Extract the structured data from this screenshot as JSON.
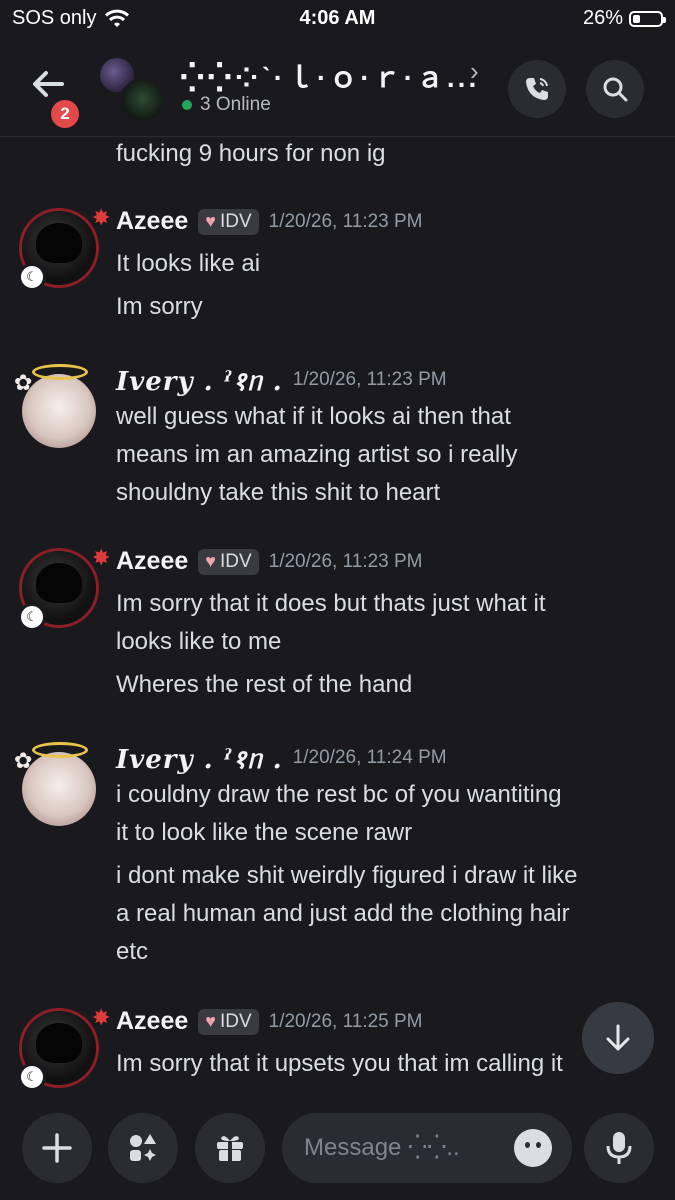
{
  "status_bar": {
    "carrier": "SOS only",
    "time": "4:06 AM",
    "battery": "26%",
    "battery_level": 0.26
  },
  "header": {
    "unread_count": "2",
    "channel_title": "⁛⁛⁘ˋ·ｌ·ｏ·ｒ·ａ...",
    "online": "3 Online"
  },
  "messages": [
    {
      "type": "continuation",
      "lines": [
        "fucking 9 hours for non ig"
      ]
    },
    {
      "author": "Azeee",
      "tag": "IDV",
      "timestamp": "1/20/26, 11:23 PM",
      "lines": [
        "It looks like ai",
        "Im sorry"
      ]
    },
    {
      "author": "Ivery . ˀ१ᥒ .",
      "timestamp": "1/20/26, 11:23 PM",
      "lines": [
        "well guess what if it looks ai then that",
        "means im an amazing artist so i really",
        "shouldny take this shit to heart"
      ]
    },
    {
      "author": "Azeee",
      "tag": "IDV",
      "timestamp": "1/20/26, 11:23 PM",
      "lines": [
        "Im sorry that it does but thats just what it",
        "looks like to me",
        "Wheres the rest of the hand"
      ]
    },
    {
      "author": "Ivery . ˀ१ᥒ .",
      "timestamp": "1/20/26, 11:24 PM",
      "lines": [
        "i couldny draw the rest bc of you wantiting",
        "it to look like the scene rawr",
        "i dont make shit weirdly figured i draw it like",
        "a real human and just add the clothing hair",
        "etc"
      ]
    },
    {
      "author": "Azeee",
      "tag": "IDV",
      "timestamp": "1/20/26, 11:25 PM",
      "lines": [
        "Im sorry that it upsets you that im calling it"
      ]
    }
  ],
  "composer": {
    "placeholder": "Message ⁛⁛.."
  },
  "colors": {
    "background": "#1a1a1e",
    "online_green": "#23a55a",
    "badge_red": "#e34948"
  }
}
